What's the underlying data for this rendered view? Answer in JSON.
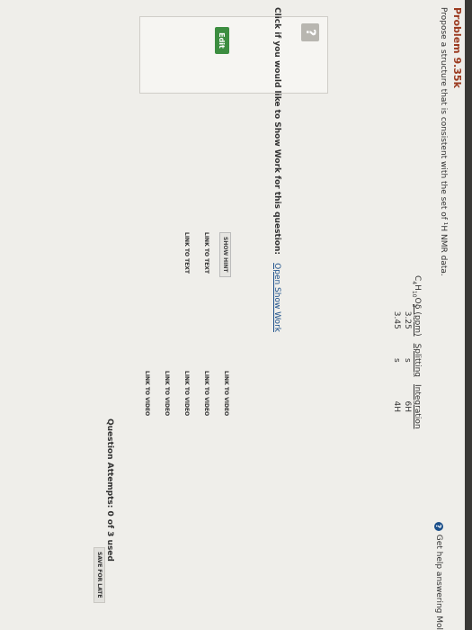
{
  "problem": {
    "title": "Problem 9.35k",
    "prompt": "Propose a structure that is consistent with the set of ¹H NMR data."
  },
  "help_link": "Get help answering Mol",
  "formula": {
    "c": "C",
    "c_sub": "4",
    "h": "H",
    "h_sub": "10",
    "o": "O",
    "o_sub": "2"
  },
  "nmr_table": {
    "headers": [
      "δ (ppm)",
      "Splitting",
      "Integration"
    ],
    "rows": [
      [
        "3.25",
        "s",
        "6H"
      ],
      [
        "3.45",
        "s",
        "4H"
      ]
    ]
  },
  "answer": {
    "placeholder_icon": "?",
    "edit_label": "Edit"
  },
  "show_work": {
    "prompt": "Click if you would like to Show Work for this question:",
    "link": "Open Show Work"
  },
  "resources": {
    "hint_label": "SHOW HINT",
    "text_links": [
      "LINK TO TEXT",
      "LINK TO TEXT"
    ],
    "video_links": [
      "LINK TO VIDEO",
      "LINK TO VIDEO",
      "LINK TO VIDEO",
      "LINK TO VIDEO",
      "LINK TO VIDEO"
    ]
  },
  "attempts": "Question Attempts: 0 of 3 used",
  "save_label": "SAVE FOR LATE"
}
